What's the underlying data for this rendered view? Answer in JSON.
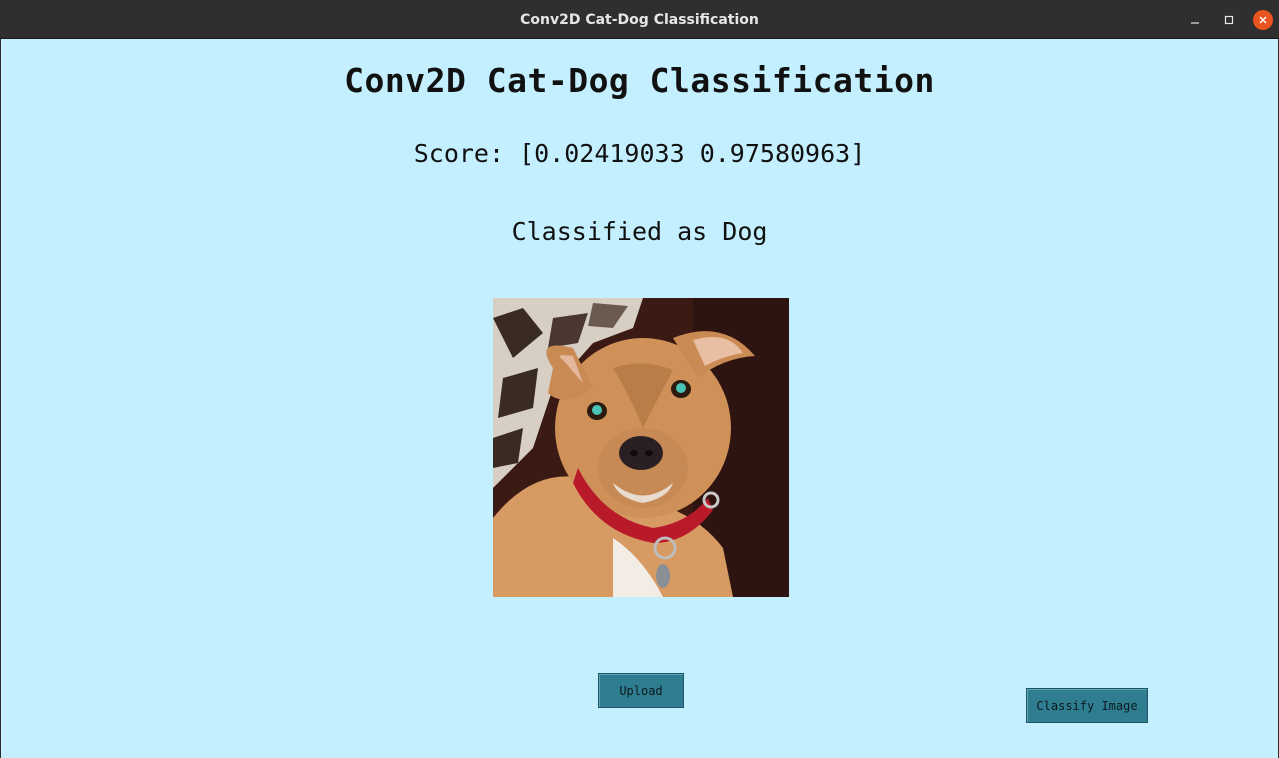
{
  "window": {
    "title": "Conv2D Cat-Dog Classification",
    "controls": [
      "minimize-icon",
      "maximize-icon",
      "close-icon"
    ]
  },
  "main": {
    "heading": "Conv2D Cat-Dog Classification",
    "score_text": "Score: [0.02419033 0.97580963]",
    "result_text": "Classified as Dog",
    "image_description_icon": "dog-photo"
  },
  "buttons": {
    "upload_label": "Upload",
    "classify_label": "Classify Image"
  },
  "colors": {
    "background": "#c4efff",
    "button": "#2f7d91",
    "titlebar": "#2f2f2f",
    "close": "#e95420"
  }
}
